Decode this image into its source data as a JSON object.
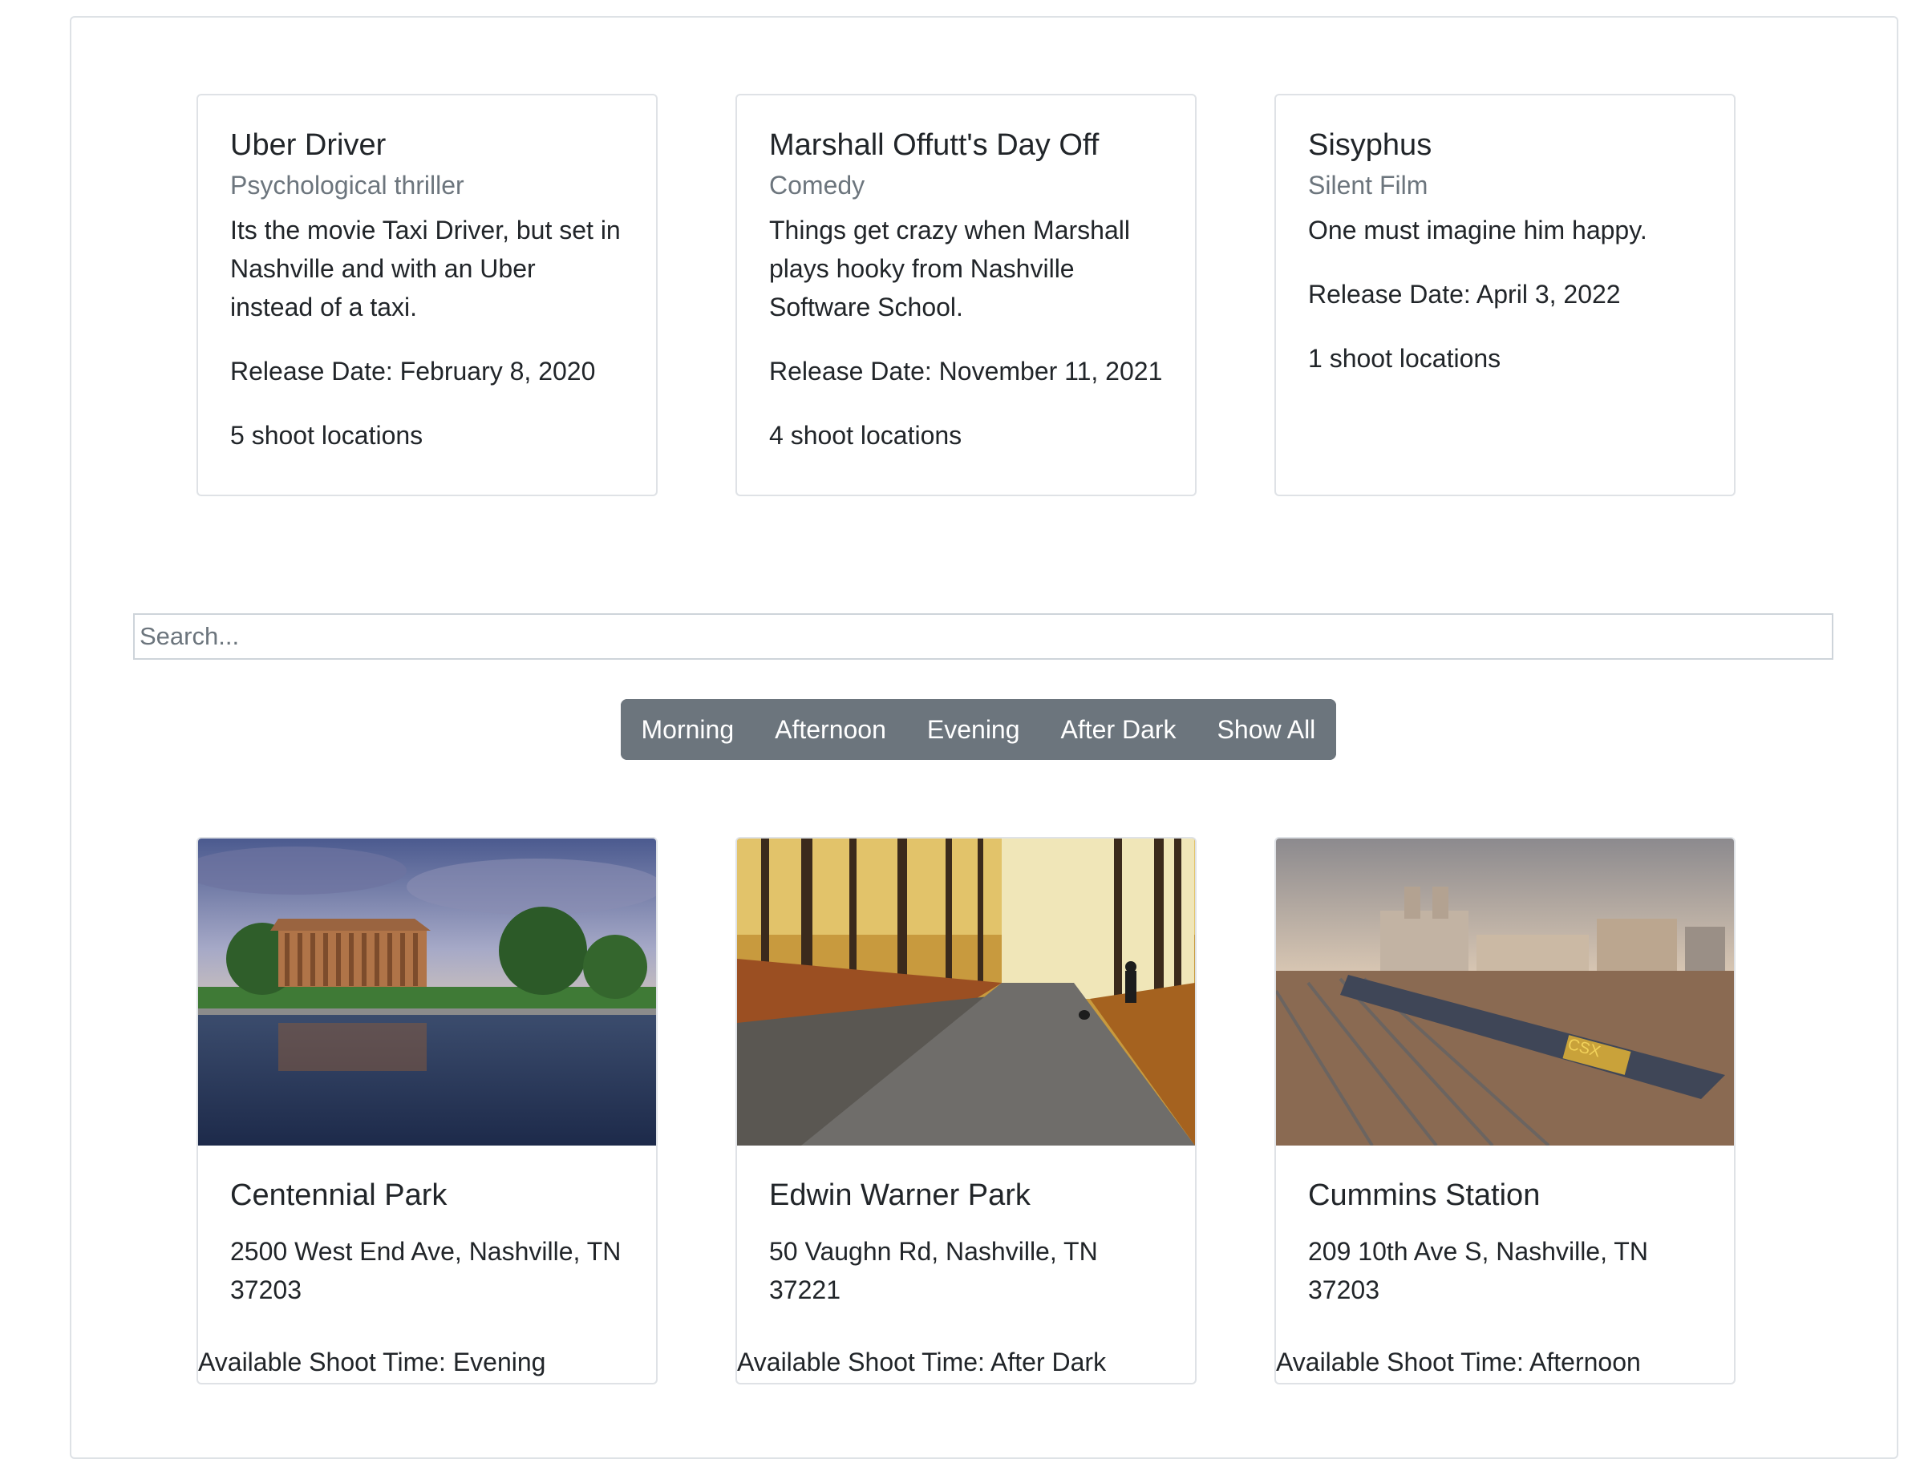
{
  "movies": [
    {
      "title": "Uber Driver",
      "genre": "Psychological thriller",
      "description": "Its the movie Taxi Driver, but set in Nashville and with an Uber instead of a taxi.",
      "release": "Release Date: February 8, 2020",
      "locations": "5 shoot locations"
    },
    {
      "title": "Marshall Offutt's Day Off",
      "genre": "Comedy",
      "description": "Things get crazy when Marshall plays hooky from Nashville Software School.",
      "release": "Release Date: November 11, 2021",
      "locations": "4 shoot locations"
    },
    {
      "title": "Sisyphus",
      "genre": "Silent Film",
      "description": "One must imagine him happy.",
      "release": "Release Date: April 3, 2022",
      "locations": "1 shoot locations"
    }
  ],
  "search": {
    "placeholder": "Search..."
  },
  "filters": [
    "Morning",
    "Afternoon",
    "Evening",
    "After Dark",
    "Show All"
  ],
  "locations": [
    {
      "name": "Centennial Park",
      "address": "2500 West End Ave, Nashville, TN 37203",
      "shoot_time": "Available Shoot Time: Evening"
    },
    {
      "name": "Edwin Warner Park",
      "address": "50 Vaughn Rd, Nashville, TN 37221",
      "shoot_time": "Available Shoot Time: After Dark"
    },
    {
      "name": "Cummins Station",
      "address": "209 10th Ave S, Nashville, TN 37203",
      "shoot_time": "Available Shoot Time: Afternoon"
    }
  ],
  "image_text": {
    "train_logo": "CSX"
  }
}
